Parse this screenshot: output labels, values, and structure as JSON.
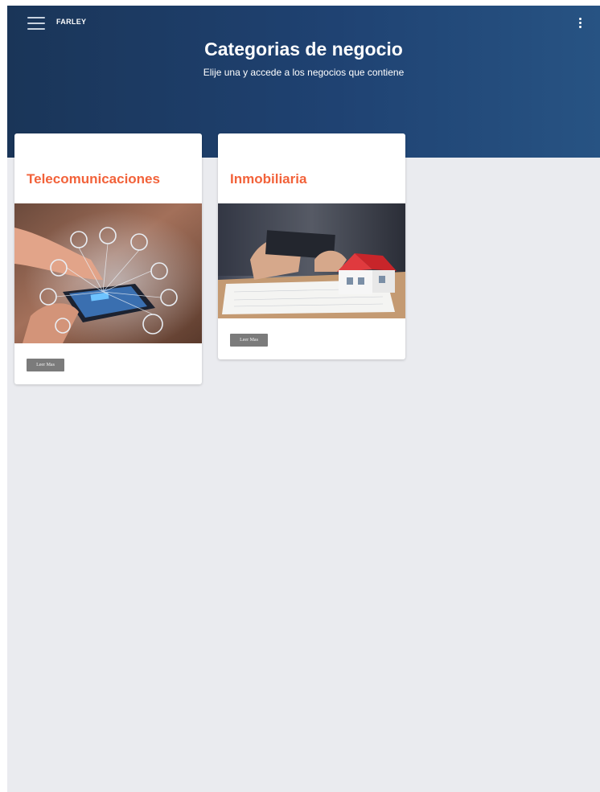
{
  "app": {
    "brand": "FARLEY"
  },
  "header": {
    "title": "Categorias de negocio",
    "subtitle": "Elije una y accede a los negocios que contiene"
  },
  "icons": {
    "menu": "hamburger-menu-icon",
    "more": "more-vertical-icon"
  },
  "categories": [
    {
      "title": "Telecomunicaciones",
      "button_label": "Leer Mas",
      "image": "hand-holding-smartphone-with-network-icons"
    },
    {
      "title": "Inmobiliaria",
      "button_label": "Leer Mas",
      "image": "businessmen-with-tablet-and-house-model"
    }
  ],
  "colors": {
    "header_gradient_start": "#1a3558",
    "header_gradient_end": "#275383",
    "card_title": "#f2623a",
    "page_background": "#eaebef",
    "button_background": "#7b7b7b"
  }
}
